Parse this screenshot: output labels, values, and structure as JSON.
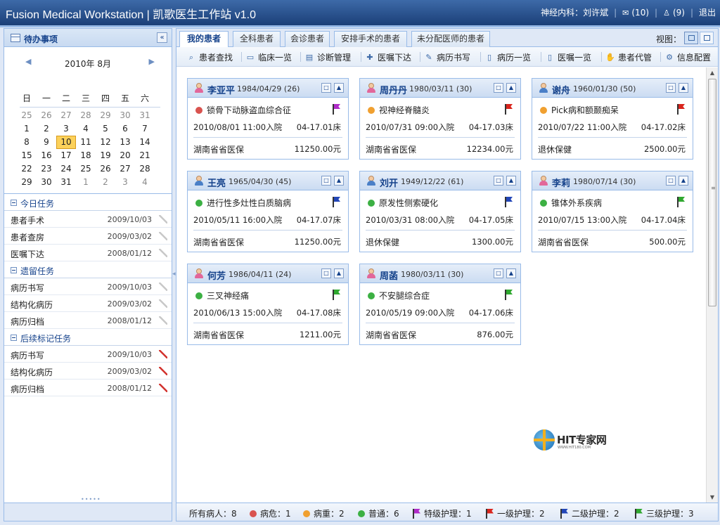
{
  "header": {
    "title": "Fusion Medical Workstation | 凯歌医生工作站 v1.0",
    "user": "神经内科：刘许斌",
    "messages": "(10)",
    "people": "(9)",
    "logout": "退出"
  },
  "left_panel": {
    "title": "待办事项",
    "calendar": {
      "month_title": "2010年 8月",
      "weekdays": [
        "日",
        "一",
        "二",
        "三",
        "四",
        "五",
        "六"
      ],
      "days": [
        "25",
        "26",
        "27",
        "28",
        "29",
        "30",
        "31",
        "1",
        "2",
        "3",
        "4",
        "5",
        "6",
        "7",
        "8",
        "9",
        "10",
        "11",
        "12",
        "13",
        "14",
        "15",
        "16",
        "17",
        "18",
        "19",
        "20",
        "21",
        "22",
        "23",
        "24",
        "25",
        "26",
        "27",
        "28",
        "29",
        "30",
        "31",
        "1",
        "2",
        "3",
        "4"
      ],
      "selected": "10"
    },
    "sections": [
      {
        "label": "今日任务",
        "items": [
          {
            "name": "患者手术",
            "date": "2009/10/03",
            "pinned": false
          },
          {
            "name": "患者查房",
            "date": "2009/03/02",
            "pinned": false
          },
          {
            "name": "医嘱下达",
            "date": "2008/01/12",
            "pinned": false
          }
        ]
      },
      {
        "label": "遗留任务",
        "items": [
          {
            "name": "病历书写",
            "date": "2009/10/03",
            "pinned": false
          },
          {
            "name": "结构化病历",
            "date": "2009/03/02",
            "pinned": false
          },
          {
            "name": "病历归档",
            "date": "2008/01/12",
            "pinned": false
          }
        ]
      },
      {
        "label": "后续标记任务",
        "items": [
          {
            "name": "病历书写",
            "date": "2009/10/03",
            "pinned": true
          },
          {
            "name": "结构化病历",
            "date": "2009/03/02",
            "pinned": true
          },
          {
            "name": "病历归档",
            "date": "2008/01/12",
            "pinned": true
          }
        ]
      }
    ]
  },
  "tabs": [
    "我的患者",
    "全科患者",
    "会诊患者",
    "安排手术的患者",
    "未分配医师的患者"
  ],
  "view_label": "视图：",
  "toolbar": [
    "患者查找",
    "临床一览",
    "诊断管理",
    "医嘱下达",
    "病历书写",
    "病历一览",
    "医嘱一览",
    "患者代管",
    "信息配置"
  ],
  "colors": {
    "critical": "#d9534f",
    "serious": "#f0a030",
    "normal": "#3cb043",
    "flag_special": "#b02cc9",
    "flag_level1": "#d9251d",
    "flag_level2": "#2246b8",
    "flag_level3": "#2fa82f"
  },
  "patients": [
    {
      "name": "李亚平",
      "info": "1984/04/29 (26)",
      "gender": "female",
      "status": "critical",
      "flag": "flag_special",
      "diagnosis": "锁骨下动脉盗血综合征",
      "admission": "2010/08/01 11:00入院",
      "bed": "04-17.01床",
      "insurance": "湖南省省医保",
      "fee": "11250.00元"
    },
    {
      "name": "周丹丹",
      "info": "1980/03/11 (30)",
      "gender": "female",
      "status": "serious",
      "flag": "flag_level1",
      "diagnosis": "视神经脊髓炎",
      "admission": "2010/07/31 09:00入院",
      "bed": "04-17.03床",
      "insurance": "湖南省省医保",
      "fee": "12234.00元"
    },
    {
      "name": "谢舟",
      "info": "1960/01/30 (50)",
      "gender": "male",
      "status": "serious",
      "flag": "flag_level1",
      "diagnosis": "Pick病和额颞痴呆",
      "admission": "2010/07/22 11:00入院",
      "bed": "04-17.02床",
      "insurance": "退休保健",
      "fee": "2500.00元"
    },
    {
      "name": "王亮",
      "info": "1965/04/30 (45)",
      "gender": "male",
      "status": "normal",
      "flag": "flag_level2",
      "diagnosis": "进行性多灶性白质脑病",
      "admission": "2010/05/11 16:00入院",
      "bed": "04-17.07床",
      "insurance": "湖南省省医保",
      "fee": "11250.00元"
    },
    {
      "name": "刘开",
      "info": "1949/12/22 (61)",
      "gender": "male",
      "status": "normal",
      "flag": "flag_level2",
      "diagnosis": "原发性侧索硬化",
      "admission": "2010/03/31 08:00入院",
      "bed": "04-17.05床",
      "insurance": "退休保健",
      "fee": "1300.00元"
    },
    {
      "name": "李莉",
      "info": "1980/07/14 (30)",
      "gender": "female",
      "status": "normal",
      "flag": "flag_level3",
      "diagnosis": "锥体外系疾病",
      "admission": "2010/07/15 13:00入院",
      "bed": "04-17.04床",
      "insurance": "湖南省省医保",
      "fee": "500.00元"
    },
    {
      "name": "何芳",
      "info": "1986/04/11 (24)",
      "gender": "female",
      "status": "normal",
      "flag": "flag_level3",
      "diagnosis": "三叉神经痛",
      "admission": "2010/06/13 15:00入院",
      "bed": "04-17.08床",
      "insurance": "湖南省省医保",
      "fee": "1211.00元"
    },
    {
      "name": "周菡",
      "info": "1980/03/11 (30)",
      "gender": "female",
      "status": "normal",
      "flag": "flag_level3",
      "diagnosis": "不安腿综合症",
      "admission": "2010/05/19 09:00入院",
      "bed": "04-17.06床",
      "insurance": "湖南省省医保",
      "fee": "876.00元"
    }
  ],
  "watermark": {
    "text": "HIT专家网",
    "sub": "WWW.HIT180.COM"
  },
  "statusbar": {
    "total": "所有病人：8",
    "critical": "病危：1",
    "serious": "病重：2",
    "normal": "普通：6",
    "special": "特级护理：1",
    "level1": "一级护理：2",
    "level2": "二级护理：2",
    "level3": "三级护理：3"
  }
}
